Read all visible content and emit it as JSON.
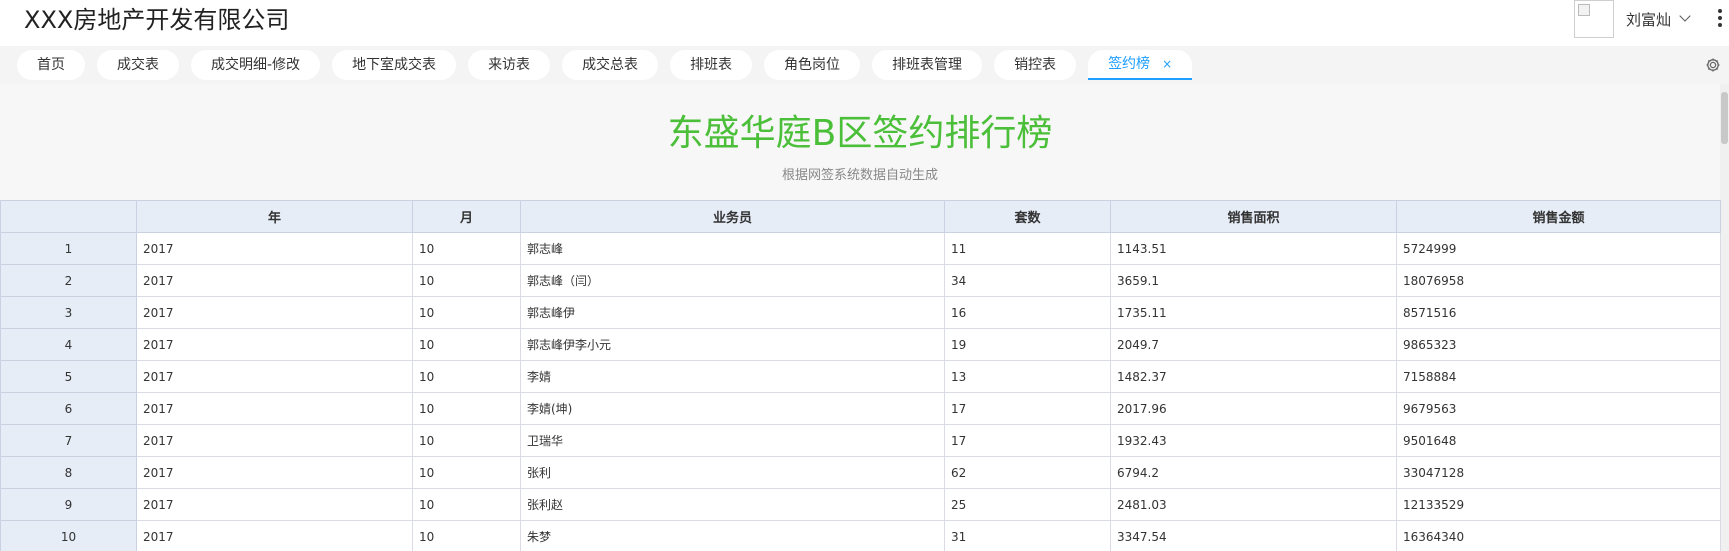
{
  "header": {
    "company": "XXX房地产开发有限公司",
    "user_name": "刘富灿"
  },
  "tabs": [
    {
      "label": "首页"
    },
    {
      "label": "成交表"
    },
    {
      "label": "成交明细-修改"
    },
    {
      "label": "地下室成交表"
    },
    {
      "label": "来访表"
    },
    {
      "label": "成交总表"
    },
    {
      "label": "排班表"
    },
    {
      "label": "角色岗位"
    },
    {
      "label": "排班表管理"
    },
    {
      "label": "销控表"
    },
    {
      "label": "签约榜",
      "active": true,
      "close": "×"
    }
  ],
  "report": {
    "title": "东盛华庭B区签约排行榜",
    "subtitle": "根据网签系统数据自动生成"
  },
  "table": {
    "columns": [
      "",
      "年",
      "月",
      "业务员",
      "套数",
      "销售面积",
      "销售金额"
    ],
    "rows": [
      [
        "1",
        "2017",
        "10",
        "郭志峰",
        "11",
        "1143.51",
        "5724999"
      ],
      [
        "2",
        "2017",
        "10",
        "郭志峰（闫）",
        "34",
        "3659.1",
        "18076958"
      ],
      [
        "3",
        "2017",
        "10",
        "郭志峰伊",
        "16",
        "1735.11",
        "8571516"
      ],
      [
        "4",
        "2017",
        "10",
        "郭志峰伊李小元",
        "19",
        "2049.7",
        "9865323"
      ],
      [
        "5",
        "2017",
        "10",
        "李婧",
        "13",
        "1482.37",
        "7158884"
      ],
      [
        "6",
        "2017",
        "10",
        "李婧(坤)",
        "17",
        "2017.96",
        "9679563"
      ],
      [
        "7",
        "2017",
        "10",
        "卫瑞华",
        "17",
        "1932.43",
        "9501648"
      ],
      [
        "8",
        "2017",
        "10",
        "张利",
        "62",
        "6794.2",
        "33047128"
      ],
      [
        "9",
        "2017",
        "10",
        "张利赵",
        "25",
        "2481.03",
        "12133529"
      ],
      [
        "10",
        "2017",
        "10",
        "朱梦",
        "31",
        "3347.54",
        "16364340"
      ]
    ]
  },
  "colors": {
    "title_green": "#4cbf3a",
    "active_tab": "#1e9fff",
    "header_cell_bg": "#e6edf7"
  }
}
